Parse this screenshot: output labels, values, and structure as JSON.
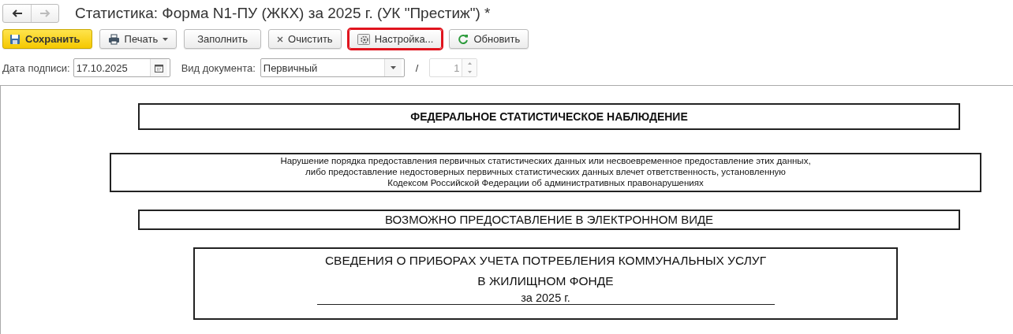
{
  "window": {
    "title": "Статистика: Форма N1-ПУ (ЖКХ) за 2025 г. (УК \"Престиж\") *",
    "nav": [
      {
        "kind": "back",
        "disabled": false
      },
      {
        "kind": "forward",
        "disabled": true
      }
    ]
  },
  "toolbar": [
    {
      "label": "Сохранить",
      "kind": "save",
      "highlighted": false
    },
    {
      "label": "Печать",
      "kind": "print",
      "highlighted": false
    },
    {
      "label": "Заполнить",
      "kind": "plain",
      "highlighted": false
    },
    {
      "label": "Очистить",
      "kind": "clear",
      "highlighted": false
    },
    {
      "label": "Настройка...",
      "kind": "settings",
      "highlighted": true
    },
    {
      "label": "Обновить",
      "kind": "refresh",
      "highlighted": false
    }
  ],
  "fields": {
    "date_label": "Дата подписи:",
    "date_value": "17.10.2025",
    "doctype_label": "Вид документа:",
    "doctype_value": "Первичный",
    "separator": "/",
    "number_value": "1",
    "number_disabled": true
  },
  "document": {
    "blocks": [
      {
        "kind": "heading",
        "lines": [
          "ФЕДЕРАЛЬНОЕ СТАТИСТИЧЕСКОЕ НАБЛЮДЕНИЕ"
        ]
      },
      {
        "kind": "notice",
        "lines": [
          "Нарушение порядка предоставления первичных статистических данных или несвоевременное предоставление этих данных,",
          "либо предоставление недостоверных первичных статистических данных влечет ответственность, установленную",
          "Кодексом Российской Федерации об административных правонарушениях"
        ]
      },
      {
        "kind": "banner",
        "lines": [
          "ВОЗМОЖНО ПРЕДОСТАВЛЕНИЕ В ЭЛЕКТРОННОМ ВИДЕ"
        ]
      },
      {
        "kind": "title",
        "lines": [
          "СВЕДЕНИЯ О ПРИБОРАХ УЧЕТА ПОТРЕБЛЕНИЯ КОММУНАЛЬНЫХ УСЛУГ",
          "В ЖИЛИЩНОМ ФОНДЕ",
          "за 2025 г."
        ]
      }
    ]
  }
}
